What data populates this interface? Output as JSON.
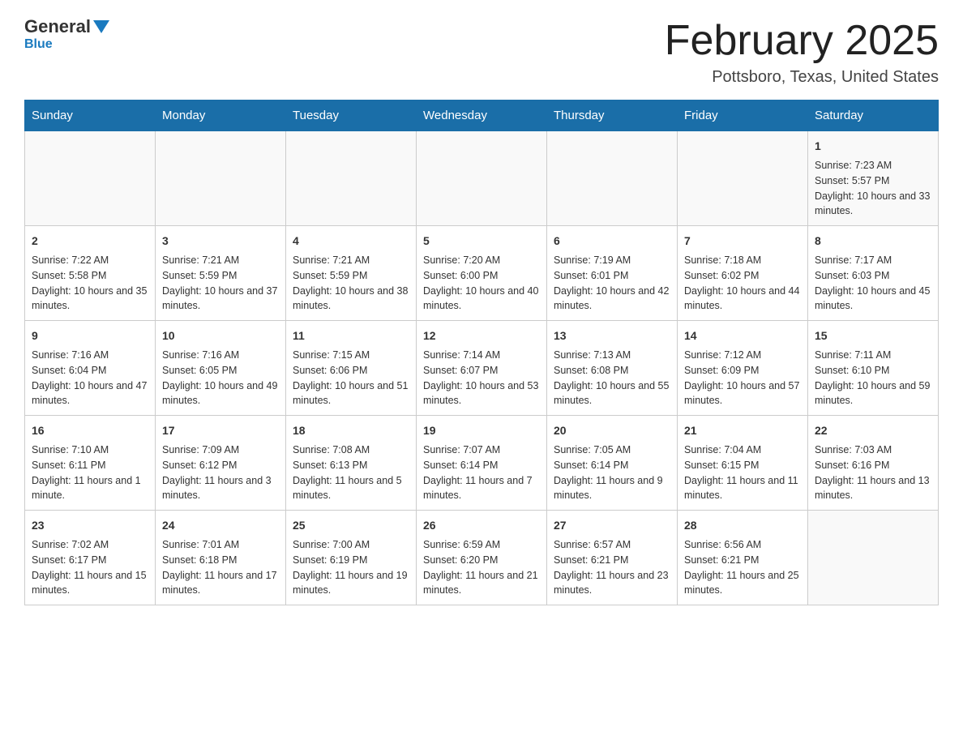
{
  "header": {
    "logo_general": "General",
    "logo_blue": "Blue",
    "month_title": "February 2025",
    "location": "Pottsboro, Texas, United States"
  },
  "weekdays": [
    "Sunday",
    "Monday",
    "Tuesday",
    "Wednesday",
    "Thursday",
    "Friday",
    "Saturday"
  ],
  "weeks": [
    [
      {
        "day": "",
        "info": ""
      },
      {
        "day": "",
        "info": ""
      },
      {
        "day": "",
        "info": ""
      },
      {
        "day": "",
        "info": ""
      },
      {
        "day": "",
        "info": ""
      },
      {
        "day": "",
        "info": ""
      },
      {
        "day": "1",
        "info": "Sunrise: 7:23 AM\nSunset: 5:57 PM\nDaylight: 10 hours and 33 minutes."
      }
    ],
    [
      {
        "day": "2",
        "info": "Sunrise: 7:22 AM\nSunset: 5:58 PM\nDaylight: 10 hours and 35 minutes."
      },
      {
        "day": "3",
        "info": "Sunrise: 7:21 AM\nSunset: 5:59 PM\nDaylight: 10 hours and 37 minutes."
      },
      {
        "day": "4",
        "info": "Sunrise: 7:21 AM\nSunset: 5:59 PM\nDaylight: 10 hours and 38 minutes."
      },
      {
        "day": "5",
        "info": "Sunrise: 7:20 AM\nSunset: 6:00 PM\nDaylight: 10 hours and 40 minutes."
      },
      {
        "day": "6",
        "info": "Sunrise: 7:19 AM\nSunset: 6:01 PM\nDaylight: 10 hours and 42 minutes."
      },
      {
        "day": "7",
        "info": "Sunrise: 7:18 AM\nSunset: 6:02 PM\nDaylight: 10 hours and 44 minutes."
      },
      {
        "day": "8",
        "info": "Sunrise: 7:17 AM\nSunset: 6:03 PM\nDaylight: 10 hours and 45 minutes."
      }
    ],
    [
      {
        "day": "9",
        "info": "Sunrise: 7:16 AM\nSunset: 6:04 PM\nDaylight: 10 hours and 47 minutes."
      },
      {
        "day": "10",
        "info": "Sunrise: 7:16 AM\nSunset: 6:05 PM\nDaylight: 10 hours and 49 minutes."
      },
      {
        "day": "11",
        "info": "Sunrise: 7:15 AM\nSunset: 6:06 PM\nDaylight: 10 hours and 51 minutes."
      },
      {
        "day": "12",
        "info": "Sunrise: 7:14 AM\nSunset: 6:07 PM\nDaylight: 10 hours and 53 minutes."
      },
      {
        "day": "13",
        "info": "Sunrise: 7:13 AM\nSunset: 6:08 PM\nDaylight: 10 hours and 55 minutes."
      },
      {
        "day": "14",
        "info": "Sunrise: 7:12 AM\nSunset: 6:09 PM\nDaylight: 10 hours and 57 minutes."
      },
      {
        "day": "15",
        "info": "Sunrise: 7:11 AM\nSunset: 6:10 PM\nDaylight: 10 hours and 59 minutes."
      }
    ],
    [
      {
        "day": "16",
        "info": "Sunrise: 7:10 AM\nSunset: 6:11 PM\nDaylight: 11 hours and 1 minute."
      },
      {
        "day": "17",
        "info": "Sunrise: 7:09 AM\nSunset: 6:12 PM\nDaylight: 11 hours and 3 minutes."
      },
      {
        "day": "18",
        "info": "Sunrise: 7:08 AM\nSunset: 6:13 PM\nDaylight: 11 hours and 5 minutes."
      },
      {
        "day": "19",
        "info": "Sunrise: 7:07 AM\nSunset: 6:14 PM\nDaylight: 11 hours and 7 minutes."
      },
      {
        "day": "20",
        "info": "Sunrise: 7:05 AM\nSunset: 6:14 PM\nDaylight: 11 hours and 9 minutes."
      },
      {
        "day": "21",
        "info": "Sunrise: 7:04 AM\nSunset: 6:15 PM\nDaylight: 11 hours and 11 minutes."
      },
      {
        "day": "22",
        "info": "Sunrise: 7:03 AM\nSunset: 6:16 PM\nDaylight: 11 hours and 13 minutes."
      }
    ],
    [
      {
        "day": "23",
        "info": "Sunrise: 7:02 AM\nSunset: 6:17 PM\nDaylight: 11 hours and 15 minutes."
      },
      {
        "day": "24",
        "info": "Sunrise: 7:01 AM\nSunset: 6:18 PM\nDaylight: 11 hours and 17 minutes."
      },
      {
        "day": "25",
        "info": "Sunrise: 7:00 AM\nSunset: 6:19 PM\nDaylight: 11 hours and 19 minutes."
      },
      {
        "day": "26",
        "info": "Sunrise: 6:59 AM\nSunset: 6:20 PM\nDaylight: 11 hours and 21 minutes."
      },
      {
        "day": "27",
        "info": "Sunrise: 6:57 AM\nSunset: 6:21 PM\nDaylight: 11 hours and 23 minutes."
      },
      {
        "day": "28",
        "info": "Sunrise: 6:56 AM\nSunset: 6:21 PM\nDaylight: 11 hours and 25 minutes."
      },
      {
        "day": "",
        "info": ""
      }
    ]
  ]
}
